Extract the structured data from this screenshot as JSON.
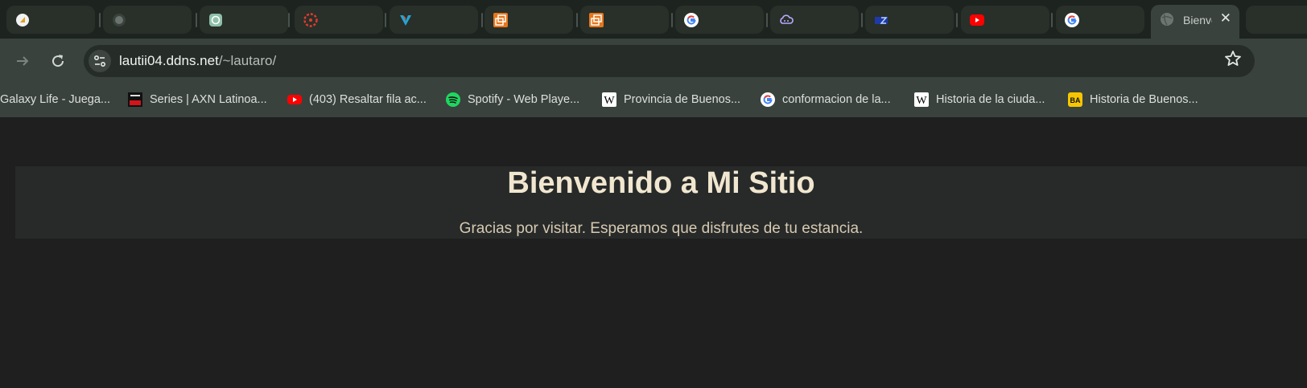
{
  "browser": {
    "active_tab": {
      "title": "Bienvenido a Mi Sitio",
      "close_glyph": "✕"
    },
    "tabs": [
      {
        "icon": "blank-doc-icon"
      },
      {
        "icon": "github-icon"
      },
      {
        "icon": "chatgpt-icon"
      },
      {
        "icon": "red-flower-icon"
      },
      {
        "icon": "v-logo-icon"
      },
      {
        "icon": "orange-window-icon"
      },
      {
        "icon": "orange-window-icon"
      },
      {
        "icon": "google-icon"
      },
      {
        "icon": "cloud-icon"
      },
      {
        "icon": "blue-flag-icon"
      },
      {
        "icon": "youtube-icon"
      },
      {
        "icon": "google-icon"
      }
    ],
    "address": {
      "host": "lautii04.ddns.net",
      "path": "/~lautaro/"
    },
    "bookmarks": [
      {
        "label": "Galaxy Life - Juega...",
        "icon": "none"
      },
      {
        "label": "Series | AXN Latinoa...",
        "icon": "axn-icon"
      },
      {
        "label": "(403) Resaltar fila ac...",
        "icon": "youtube-icon"
      },
      {
        "label": "Spotify - Web Playe...",
        "icon": "spotify-icon"
      },
      {
        "label": "Provincia de Buenos...",
        "icon": "wikipedia-icon"
      },
      {
        "label": "conformacion de la...",
        "icon": "google-icon"
      },
      {
        "label": "Historia de la ciuda...",
        "icon": "wikipedia-icon"
      },
      {
        "label": "Historia de Buenos...",
        "icon": "ba-icon"
      }
    ]
  },
  "page": {
    "heading": "Bienvenido a Mi Sitio",
    "message": "Gracias por visitar. Esperamos que disfrutes de tu estancia."
  },
  "colors": {
    "page_bg": "#1f1f1f",
    "heading": "#f1e6cf",
    "text": "#d7c9b2"
  }
}
